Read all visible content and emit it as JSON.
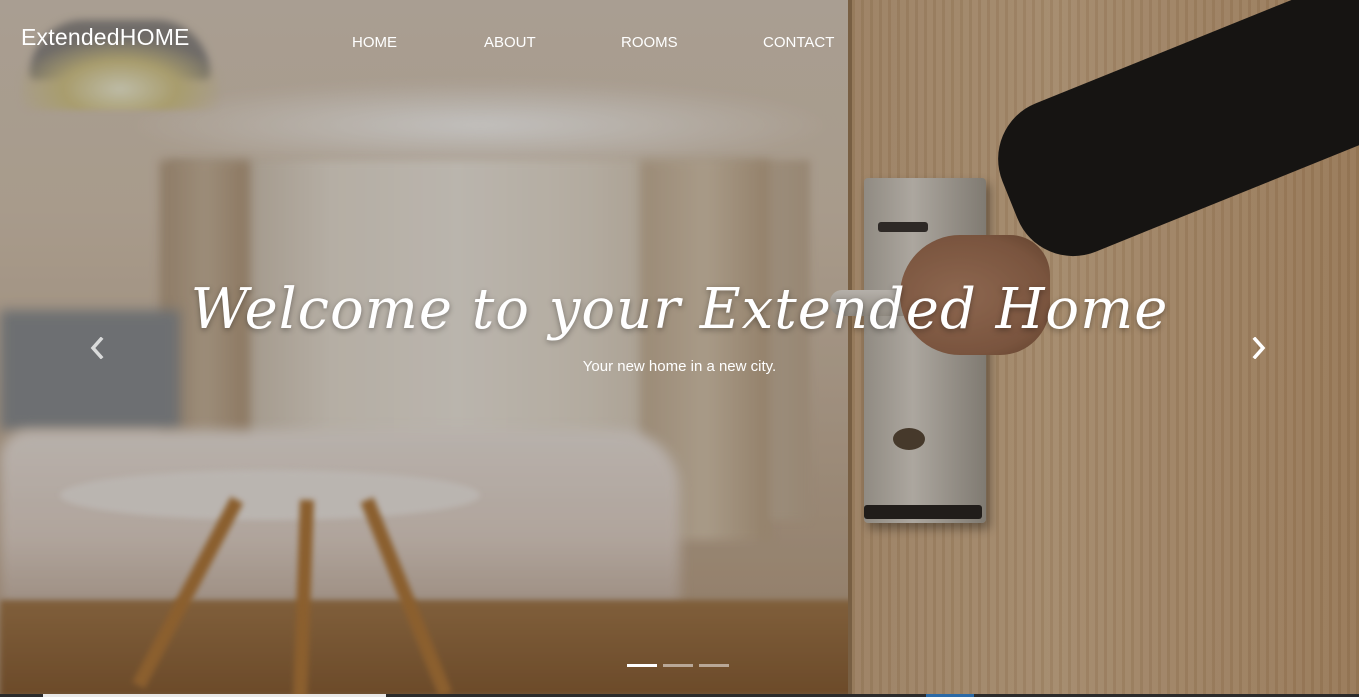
{
  "brand": {
    "name": "ExtendedHOME"
  },
  "nav": {
    "items": [
      {
        "label": "HOME"
      },
      {
        "label": "ABOUT"
      },
      {
        "label": "ROOMS"
      },
      {
        "label": "CONTACT"
      }
    ]
  },
  "hero": {
    "headline": "Welcome to your Extended Home",
    "subtitle": "Your new home in a new city.",
    "prev_icon": "chevron-left-icon",
    "next_icon": "chevron-right-icon",
    "slide_count": 3,
    "active_slide": 1
  },
  "colors": {
    "text": "#ffffff",
    "indicator_active": "#ffffff",
    "indicator_inactive": "rgba(255,255,255,0.5)"
  }
}
